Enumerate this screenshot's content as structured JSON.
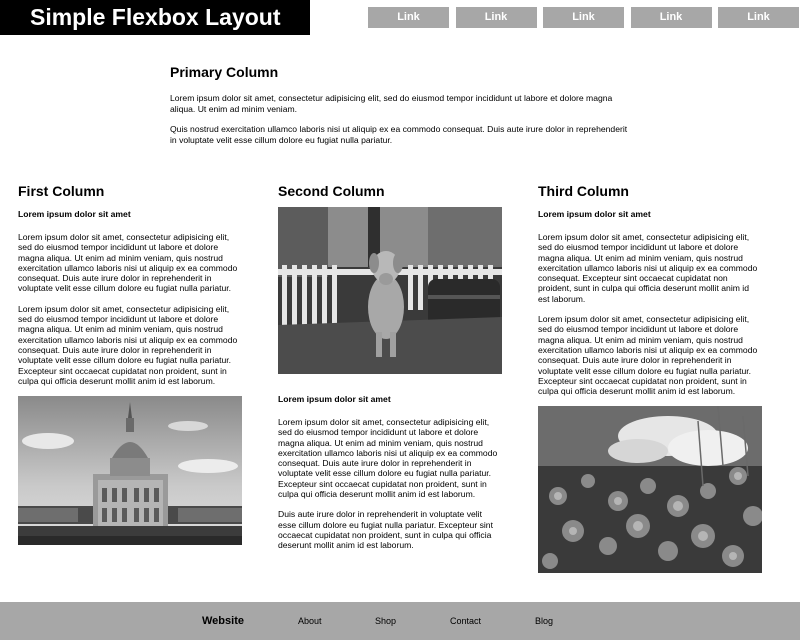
{
  "header": {
    "title": "Simple Flexbox Layout",
    "nav": [
      "Link",
      "Link",
      "Link",
      "Link",
      "Link"
    ]
  },
  "primary": {
    "heading": "Primary Column",
    "paragraphs": [
      "Lorem ipsum dolor sit amet, consectetur adipisicing elit, sed do eiusmod tempor incididunt ut labore et dolore magna aliqua. Ut enim ad minim veniam.",
      "Quis nostrud exercitation ullamco laboris nisi ut aliquip ex ea commodo consequat. Duis aute irure dolor in reprehenderit in voluptate velit esse cillum dolore eu fugiat nulla pariatur."
    ]
  },
  "columns": [
    {
      "heading": "First Column",
      "subheading": "Lorem ipsum dolor sit amet",
      "paragraphs": [
        "Lorem ipsum dolor sit amet, consectetur adipisicing elit, sed do eiusmod tempor incididunt ut labore et dolore magna aliqua. Ut enim ad minim veniam, quis nostrud exercitation ullamco laboris nisi ut aliquip ex ea commodo consequat. Duis aute irure dolor in reprehenderit in voluptate velit esse cillum dolore eu fugiat nulla pariatur.",
        "Lorem ipsum dolor sit amet, consectetur adipisicing elit, sed do eiusmod tempor incididunt ut labore et dolore magna aliqua. Ut enim ad minim veniam, quis nostrud exercitation ullamco laboris nisi ut aliquip ex ea commodo consequat. Duis aute irure dolor in reprehenderit in voluptate velit esse cillum dolore eu fugiat nulla pariatur. Excepteur sint occaecat cupidatat non proident, sunt in culpa qui officia deserunt mollit anim id est laborum."
      ]
    },
    {
      "heading": "Second Column",
      "subheading": "Lorem ipsum dolor sit amet",
      "paragraphs": [
        "Lorem ipsum dolor sit amet, consectetur adipisicing elit, sed do eiusmod tempor incididunt ut labore et dolore magna aliqua. Ut enim ad minim veniam, quis nostrud exercitation ullamco laboris nisi ut aliquip ex ea commodo consequat. Duis aute irure dolor in reprehenderit in voluptate velit esse cillum dolore eu fugiat nulla pariatur. Excepteur sint occaecat cupidatat non proident, sunt in culpa qui officia deserunt mollit anim id est laborum.",
        "Duis aute irure dolor in reprehenderit in voluptate velit esse cillum dolore eu fugiat nulla pariatur. Excepteur sint occaecat cupidatat non proident, sunt in culpa qui officia deserunt mollit anim id est laborum."
      ]
    },
    {
      "heading": "Third Column",
      "subheading": "Lorem ipsum dolor sit amet",
      "paragraphs": [
        "Lorem ipsum dolor sit amet, consectetur adipisicing elit, sed do eiusmod tempor incididunt ut labore et dolore magna aliqua. Ut enim ad minim veniam, quis nostrud exercitation ullamco laboris nisi ut aliquip ex ea commodo consequat. Excepteur sint occaecat cupidatat non proident, sunt in culpa qui officia deserunt mollit anim id est laborum.",
        "Lorem ipsum dolor sit amet, consectetur adipisicing elit, sed do eiusmod tempor incididunt ut labore et dolore magna aliqua. Ut enim ad minim veniam, quis nostrud exercitation ullamco laboris nisi ut aliquip ex ea commodo consequat. Duis aute irure dolor in reprehenderit in voluptate velit esse cillum dolore eu fugiat nulla pariatur. Excepteur sint occaecat cupidatat non proident, sunt in culpa qui officia deserunt mollit anim id est laborum."
      ]
    }
  ],
  "footer": {
    "brand": "Website",
    "links": [
      "About",
      "Shop",
      "Contact",
      "Blog"
    ]
  },
  "colors": {
    "header_bg": "#000000",
    "nav_bg": "#a7a7a7",
    "footer_bg": "#a7a7a7"
  }
}
